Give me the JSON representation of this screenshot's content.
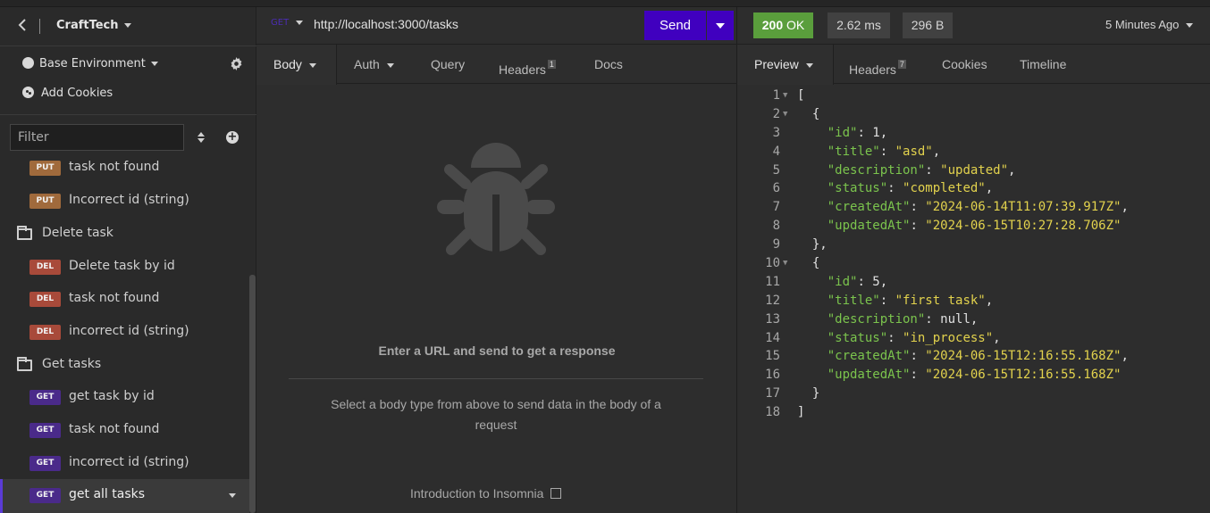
{
  "sidebar": {
    "project_name": "CraftTech",
    "environment": "Base Environment",
    "add_cookies": "Add Cookies",
    "filter_placeholder": "Filter",
    "items": [
      {
        "type": "request",
        "method": "PUT",
        "label": "task not found"
      },
      {
        "type": "request",
        "method": "PUT",
        "label": "Incorrect id (string)"
      },
      {
        "type": "folder",
        "label": "Delete task"
      },
      {
        "type": "request",
        "method": "DEL",
        "label": "Delete task by id"
      },
      {
        "type": "request",
        "method": "DEL",
        "label": "task not found"
      },
      {
        "type": "request",
        "method": "DEL",
        "label": "incorrect id (string)"
      },
      {
        "type": "folder",
        "label": "Get tasks"
      },
      {
        "type": "request",
        "method": "GET",
        "label": "get task by id"
      },
      {
        "type": "request",
        "method": "GET",
        "label": "task not found"
      },
      {
        "type": "request",
        "method": "GET",
        "label": "incorrect id (string)"
      },
      {
        "type": "request",
        "method": "GET",
        "label": "get all tasks",
        "active": true
      }
    ]
  },
  "request": {
    "method": "GET",
    "url": "http://localhost:3000/tasks",
    "send_label": "Send",
    "tabs": [
      {
        "label": "Body",
        "dropdown": true,
        "active": true
      },
      {
        "label": "Auth",
        "dropdown": true
      },
      {
        "label": "Query"
      },
      {
        "label": "Headers",
        "count": "1"
      },
      {
        "label": "Docs"
      }
    ],
    "empty_title": "Enter a URL and send to get a response",
    "empty_desc": "Select a body type from above to send data in the body of a request",
    "intro_link": "Introduction to Insomnia"
  },
  "response": {
    "status": "200",
    "status_text": "OK",
    "time": "2.62 ms",
    "size": "296 B",
    "age": "5 Minutes Ago",
    "tabs": [
      {
        "label": "Preview",
        "dropdown": true,
        "active": true
      },
      {
        "label": "Headers",
        "count": "7"
      },
      {
        "label": "Cookies"
      },
      {
        "label": "Timeline"
      }
    ],
    "lines": [
      "[",
      "  {",
      "    \"id\": 1,",
      "    \"title\": \"asd\",",
      "    \"description\": \"updated\",",
      "    \"status\": \"completed\",",
      "    \"createdAt\": \"2024-06-14T11:07:39.917Z\",",
      "    \"updatedAt\": \"2024-06-15T10:27:28.706Z\"",
      "  },",
      "  {",
      "    \"id\": 5,",
      "    \"title\": \"first task\",",
      "    \"description\": null,",
      "    \"status\": \"in_process\",",
      "    \"createdAt\": \"2024-06-15T12:16:55.168Z\",",
      "    \"updatedAt\": \"2024-06-15T12:16:55.168Z\"",
      "  }",
      "]"
    ],
    "folds": [
      1,
      2,
      10
    ]
  },
  "colors": {
    "accent": "#4000bf",
    "status_ok": "#5a9e3c",
    "json_key": "#7bc44d",
    "json_string": "#e2d24d"
  },
  "icons": [
    "chevron-left-icon",
    "gear-icon",
    "cookie-icon",
    "sort-icon",
    "add-icon",
    "folder-icon",
    "bug-icon",
    "external-link-icon"
  ]
}
